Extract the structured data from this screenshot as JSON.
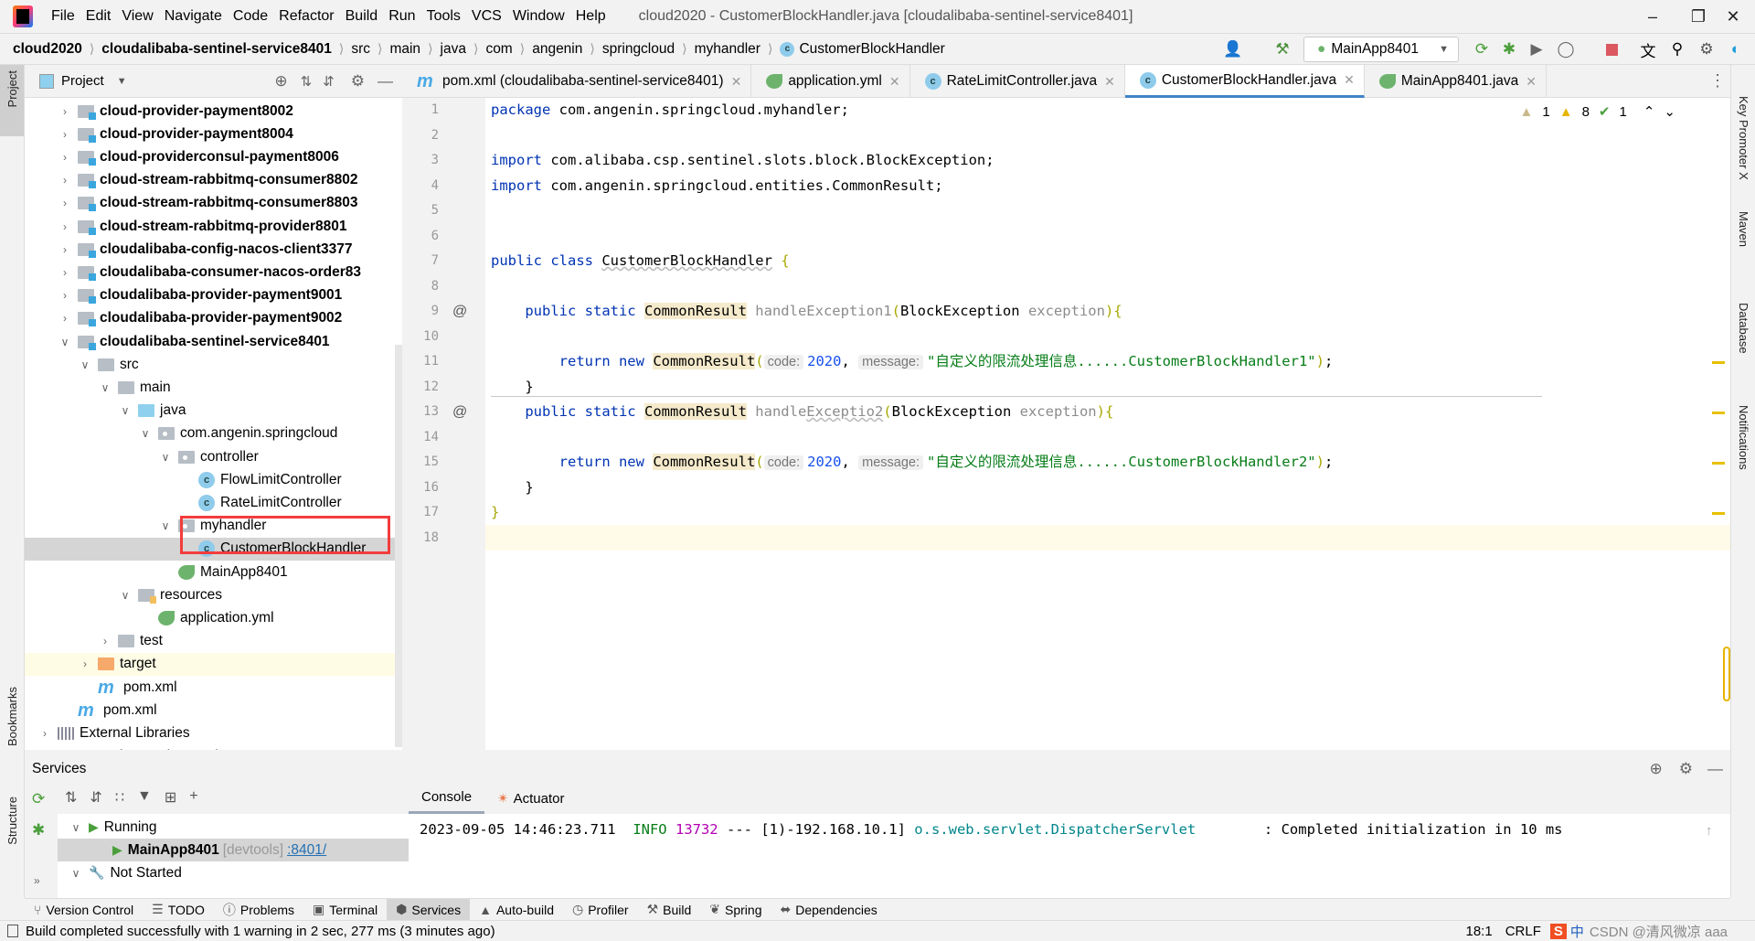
{
  "menu": {
    "items": [
      "File",
      "Edit",
      "View",
      "Navigate",
      "Code",
      "Refactor",
      "Build",
      "Run",
      "Tools",
      "VCS",
      "Window",
      "Help"
    ],
    "window_title": "cloud2020 - CustomerBlockHandler.java [cloudalibaba-sentinel-service8401]"
  },
  "breadcrumb": [
    "cloud2020",
    "cloudalibaba-sentinel-service8401",
    "src",
    "main",
    "java",
    "com",
    "angenin",
    "springcloud",
    "myhandler",
    "CustomerBlockHandler"
  ],
  "toolbar": {
    "run_config": "MainApp8401"
  },
  "left_stripe": {
    "project": "Project",
    "bookmarks": "Bookmarks",
    "structure": "Structure"
  },
  "right_stripe": [
    "Key Promoter X",
    "Maven",
    "Database",
    "Notifications"
  ],
  "project": {
    "title": "Project",
    "tree": [
      {
        "label": "cloud-provider-payment8002",
        "depth": 1,
        "icon": "module",
        "arrow": "right",
        "bold": true
      },
      {
        "label": "cloud-provider-payment8004",
        "depth": 1,
        "icon": "module",
        "arrow": "right",
        "bold": true
      },
      {
        "label": "cloud-providerconsul-payment8006",
        "depth": 1,
        "icon": "module",
        "arrow": "right",
        "bold": true
      },
      {
        "label": "cloud-stream-rabbitmq-consumer8802",
        "depth": 1,
        "icon": "module",
        "arrow": "right",
        "bold": true
      },
      {
        "label": "cloud-stream-rabbitmq-consumer8803",
        "depth": 1,
        "icon": "module",
        "arrow": "right",
        "bold": true
      },
      {
        "label": "cloud-stream-rabbitmq-provider8801",
        "depth": 1,
        "icon": "module",
        "arrow": "right",
        "bold": true
      },
      {
        "label": "cloudalibaba-config-nacos-client3377",
        "depth": 1,
        "icon": "module",
        "arrow": "right",
        "bold": true
      },
      {
        "label": "cloudalibaba-consumer-nacos-order83",
        "depth": 1,
        "icon": "module",
        "arrow": "right",
        "bold": true
      },
      {
        "label": "cloudalibaba-provider-payment9001",
        "depth": 1,
        "icon": "module",
        "arrow": "right",
        "bold": true
      },
      {
        "label": "cloudalibaba-provider-payment9002",
        "depth": 1,
        "icon": "module",
        "arrow": "right",
        "bold": true
      },
      {
        "label": "cloudalibaba-sentinel-service8401",
        "depth": 1,
        "icon": "module",
        "arrow": "down",
        "bold": true
      },
      {
        "label": "src",
        "depth": 2,
        "icon": "folder",
        "arrow": "down"
      },
      {
        "label": "main",
        "depth": 3,
        "icon": "folder",
        "arrow": "down"
      },
      {
        "label": "java",
        "depth": 4,
        "icon": "src",
        "arrow": "down"
      },
      {
        "label": "com.angenin.springcloud",
        "depth": 5,
        "icon": "pkg",
        "arrow": "down"
      },
      {
        "label": "controller",
        "depth": 6,
        "icon": "pkg",
        "arrow": "down"
      },
      {
        "label": "FlowLimitController",
        "depth": 7,
        "icon": "class",
        "arrow": ""
      },
      {
        "label": "RateLimitController",
        "depth": 7,
        "icon": "class",
        "arrow": ""
      },
      {
        "label": "myhandler",
        "depth": 6,
        "icon": "pkg",
        "arrow": "down"
      },
      {
        "label": "CustomerBlockHandler",
        "depth": 7,
        "icon": "class",
        "arrow": "",
        "selected": true
      },
      {
        "label": "MainApp8401",
        "depth": 6,
        "icon": "spring",
        "arrow": ""
      },
      {
        "label": "resources",
        "depth": 4,
        "icon": "res",
        "arrow": "down"
      },
      {
        "label": "application.yml",
        "depth": 5,
        "icon": "spring",
        "arrow": ""
      },
      {
        "label": "test",
        "depth": 3,
        "icon": "folder",
        "arrow": "right"
      },
      {
        "label": "target",
        "depth": 2,
        "icon": "target",
        "arrow": "right",
        "highlight": true
      },
      {
        "label": "pom.xml",
        "depth": 2,
        "icon": "maven",
        "arrow": ""
      },
      {
        "label": "pom.xml",
        "depth": 1,
        "icon": "maven",
        "arrow": ""
      },
      {
        "label": "External Libraries",
        "depth": 0,
        "icon": "lib",
        "arrow": "right"
      },
      {
        "label": "Scratches and Consoles",
        "depth": 0,
        "icon": "scratch",
        "arrow": "right"
      }
    ]
  },
  "tabs": [
    {
      "label": "pom.xml (cloudalibaba-sentinel-service8401)",
      "icon": "maven"
    },
    {
      "label": "application.yml",
      "icon": "spring"
    },
    {
      "label": "RateLimitController.java",
      "icon": "class"
    },
    {
      "label": "CustomerBlockHandler.java",
      "icon": "class",
      "active": true
    },
    {
      "label": "MainApp8401.java",
      "icon": "spring"
    }
  ],
  "inspections": {
    "weak_warnings": "1",
    "warnings": "8",
    "ok": "1"
  },
  "editor": {
    "current_line": 18,
    "lines": [
      [
        {
          "t": "package",
          "c": "kw"
        },
        {
          "t": " com.angenin.springcloud.myhandler;"
        }
      ],
      [],
      [
        {
          "t": "import",
          "c": "kw"
        },
        {
          "t": " com.alibaba.csp.sentinel.slots.block.BlockException;"
        }
      ],
      [
        {
          "t": "import",
          "c": "kw"
        },
        {
          "t": " com.angenin.springcloud.entities.CommonResult;"
        }
      ],
      [],
      [],
      [
        {
          "t": "public class ",
          "c": "kw"
        },
        {
          "t": "CustomerBlockHandler",
          "c": "ul"
        },
        {
          "t": " "
        },
        {
          "t": "{",
          "c": "br"
        }
      ],
      [],
      [
        {
          "t": "    "
        },
        {
          "t": "public static ",
          "c": "kw"
        },
        {
          "t": "CommonResult",
          "c": "ty"
        },
        {
          "t": " handleException1",
          "c": "mu"
        },
        {
          "t": "(",
          "c": "br"
        },
        {
          "t": "BlockException "
        },
        {
          "t": "exception",
          "c": "mu"
        },
        {
          "t": ")",
          "c": "br"
        },
        {
          "t": "{",
          "c": "br"
        }
      ],
      [],
      [
        {
          "t": "        "
        },
        {
          "t": "return new ",
          "c": "kw"
        },
        {
          "t": "CommonResult",
          "c": "ty"
        },
        {
          "t": "(",
          "c": "br"
        },
        {
          "t": "code:",
          "c": "hint"
        },
        {
          "t": "2020",
          "c": "nu"
        },
        {
          "t": ", "
        },
        {
          "t": "message:",
          "c": "hint"
        },
        {
          "t": "\"自定义的限流处理信息......CustomerBlockHandler1\"",
          "c": "st"
        },
        {
          "t": ")",
          "c": "br"
        },
        {
          "t": ";"
        }
      ],
      [
        {
          "t": "    }"
        }
      ],
      [
        {
          "t": "    "
        },
        {
          "t": "public static ",
          "c": "kw"
        },
        {
          "t": "CommonResult",
          "c": "ty"
        },
        {
          "t": " handle",
          "c": "mu"
        },
        {
          "t": "Exceptio2",
          "c": "mu ul"
        },
        {
          "t": "(",
          "c": "br"
        },
        {
          "t": "BlockException "
        },
        {
          "t": "exception",
          "c": "mu"
        },
        {
          "t": ")",
          "c": "br"
        },
        {
          "t": "{",
          "c": "br"
        }
      ],
      [],
      [
        {
          "t": "        "
        },
        {
          "t": "return new ",
          "c": "kw"
        },
        {
          "t": "CommonResult",
          "c": "ty"
        },
        {
          "t": "(",
          "c": "br"
        },
        {
          "t": "code:",
          "c": "hint"
        },
        {
          "t": "2020",
          "c": "nu"
        },
        {
          "t": ", "
        },
        {
          "t": "message:",
          "c": "hint"
        },
        {
          "t": "\"自定义的限流处理信息......CustomerBlockHandler2\"",
          "c": "st"
        },
        {
          "t": ")",
          "c": "br"
        },
        {
          "t": ";"
        }
      ],
      [
        {
          "t": "    }"
        }
      ],
      [
        {
          "t": "}",
          "c": "br"
        }
      ],
      []
    ],
    "annotations": {
      "9": "@",
      "13": "@"
    }
  },
  "services": {
    "title": "Services",
    "tree": [
      {
        "label": "Running",
        "depth": 0,
        "arrow": "down",
        "icon": "run"
      },
      {
        "label": "MainApp8401",
        "extra": "[devtools]",
        "link": ":8401/",
        "depth": 1,
        "icon": "run",
        "selected": true
      },
      {
        "label": "Not Started",
        "depth": 0,
        "arrow": "down",
        "icon": "wrench"
      }
    ],
    "console_tabs": [
      "Console",
      "Actuator"
    ],
    "log": {
      "timestamp": "2023-09-05 14:46:23.711",
      "level": "INFO",
      "pid": "13732",
      "thread": " --- [1)-192.168.10.1] ",
      "logger": "o.s.web.servlet.DispatcherServlet",
      "message": "        : Completed initialization in 10 ms"
    }
  },
  "bottom_tools": [
    {
      "label": "Version Control",
      "icon": "vcs-icon"
    },
    {
      "label": "TODO",
      "icon": "list-icon"
    },
    {
      "label": "Problems",
      "icon": "problems-icon"
    },
    {
      "label": "Terminal",
      "icon": "terminal-icon"
    },
    {
      "label": "Services",
      "icon": "services-icon",
      "active": true
    },
    {
      "label": "Auto-build",
      "icon": "warning-icon"
    },
    {
      "label": "Profiler",
      "icon": "profiler-icon"
    },
    {
      "label": "Build",
      "icon": "hammer-icon"
    },
    {
      "label": "Spring",
      "icon": "spring-icon"
    },
    {
      "label": "Dependencies",
      "icon": "dependencies-icon"
    }
  ],
  "status": {
    "message": "Build completed successfully with 1 warning in 2 sec, 277 ms (3 minutes ago)",
    "position": "18:1",
    "line_sep": "CRLF",
    "ime": "中",
    "watermark": "CSDN @清风微凉 aaa"
  },
  "colors": {
    "accent": "#4083c9",
    "selection_box": "#f33c3c",
    "keyword": "#0033b3",
    "string": "#067d17"
  }
}
